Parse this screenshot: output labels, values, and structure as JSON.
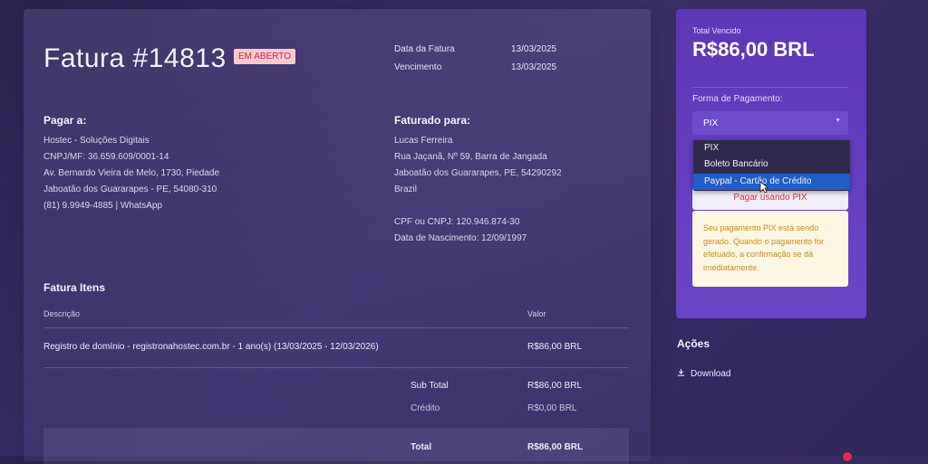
{
  "invoice": {
    "title": "Fatura #14813",
    "status": "EM ABERTO",
    "date_label": "Data da Fatura",
    "date_value": "13/03/2025",
    "due_label": "Vencimento",
    "due_value": "13/03/2025",
    "pay_to": {
      "heading": "Pagar a:",
      "lines": [
        "Hostec - Soluções Digitais",
        "CNPJ/MF: 36.659.609/0001-14",
        "Av. Bernardo Vieira de Melo, 1730, Piedade",
        "Jaboatão dos Guararapes - PE, 54080-310",
        "(81) 9.9949-4885 | WhatsApp"
      ]
    },
    "billed_to": {
      "heading": "Faturado para:",
      "lines": [
        "Lucas Ferreira",
        "Rua Jaçanã, Nº 59, Barra de Jangada",
        "Jaboatão dos Guararapes, PE, 54290292",
        "Brazil"
      ],
      "cpf": "CPF ou CNPJ: 120.946.874-30",
      "birth": "Data de Nascimento: 12/09/1997"
    },
    "items": {
      "heading": "Fatura Itens",
      "col_desc": "Descrição",
      "col_value": "Valor",
      "rows": [
        {
          "desc": "Registro de domínio - registronahostec.com.br - 1 ano(s) (13/03/2025 - 12/03/2026)",
          "value": "R$86,00 BRL"
        }
      ]
    },
    "summary": {
      "subtotal_label": "Sub Total",
      "subtotal_value": "R$86,00 BRL",
      "credit_label": "Crédito",
      "credit_value": "R$0,00 BRL",
      "total_label": "Total",
      "total_value": "R$86,00 BRL"
    }
  },
  "payment": {
    "due_label": "Total Vencido",
    "due_amount": "R$86,00 BRL",
    "method_label": "Forma de Pagamento:",
    "selected": "PIX",
    "options": [
      "PIX",
      "Boleto Bancário",
      "Paypal - Cartão de Crédito"
    ],
    "highlighted_option": "Paypal - Cartão de Crédito",
    "button_label": "Pagar usando PIX",
    "notice": "Seu pagamento PIX está sendo gerado. Quando o pagamento for efetuado, a confirmação se dá imediatamente."
  },
  "actions": {
    "heading": "Ações",
    "download": "Download"
  },
  "colors": {
    "accent": "#5c37b6",
    "badge_bg": "#f7c9cf",
    "badge_text": "#c0303e",
    "highlight": "#1f5fc4",
    "notice_bg": "#fdf6e3",
    "notice_text": "#c98d1b"
  },
  "icons": {
    "download": "download-icon",
    "select_caret": "caret-down-icon",
    "cursor": "mouse-pointer-icon"
  }
}
